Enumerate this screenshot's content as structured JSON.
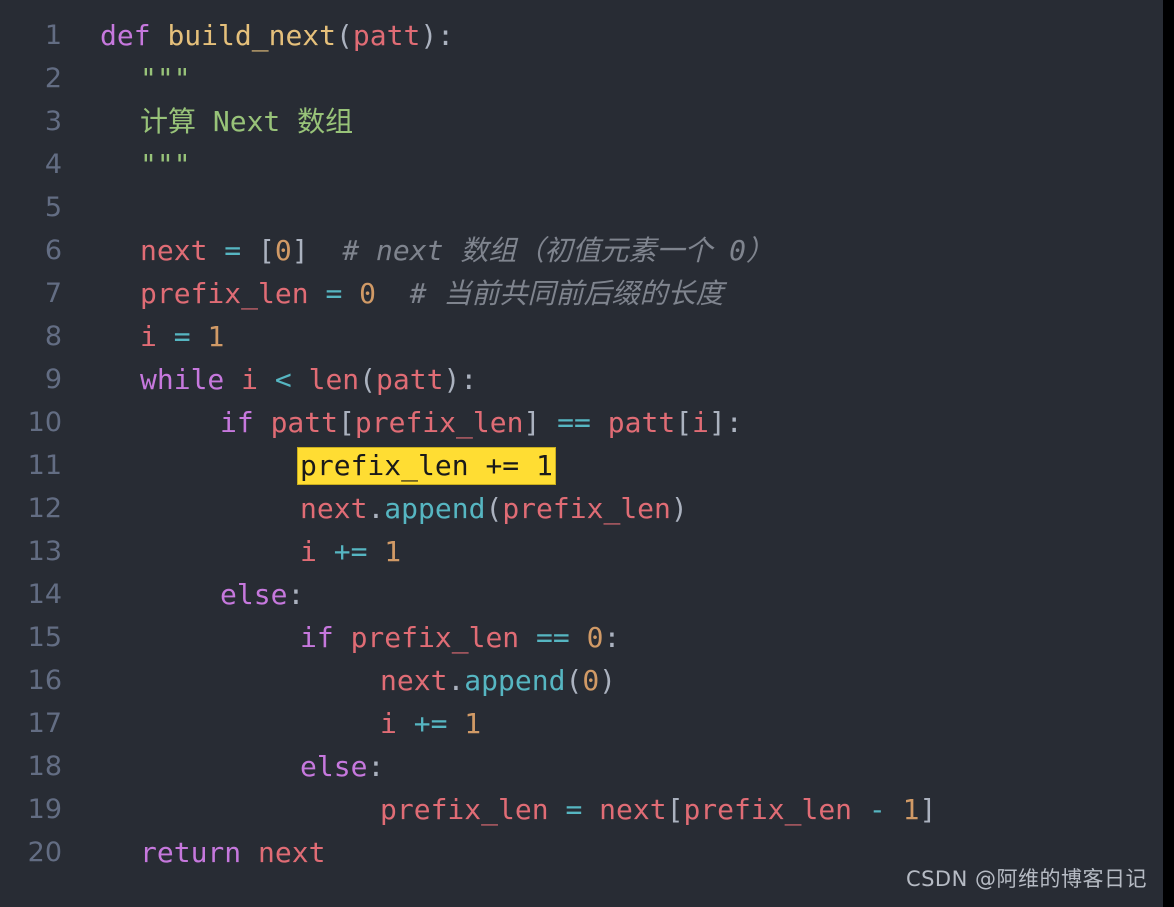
{
  "editor": {
    "language": "python",
    "theme": "One Dark",
    "background_color": "#282c34",
    "gutter_color": "#636d83",
    "highlight_color": "#ffdd33",
    "highlight_text_color": "#1a1a1a",
    "font_size_px": 28,
    "line_height_px": 43,
    "total_lines": 20
  },
  "lines": [
    {
      "number": "1",
      "text": "    def build_next(patt):"
    },
    {
      "number": "2",
      "text": "        \"\"\""
    },
    {
      "number": "3",
      "text": "        计算 Next 数组"
    },
    {
      "number": "4",
      "text": "        \"\"\""
    },
    {
      "number": "5",
      "text": ""
    },
    {
      "number": "6",
      "text": "        next = [0]  # next 数组（初值元素一个 0）"
    },
    {
      "number": "7",
      "text": "        prefix_len = 0  # 当前共同前后缀的长度"
    },
    {
      "number": "8",
      "text": "        i = 1"
    },
    {
      "number": "9",
      "text": "        while i < len(patt):"
    },
    {
      "number": "10",
      "text": "            if patt[prefix_len] == patt[i]:"
    },
    {
      "number": "11",
      "text": "                prefix_len += 1"
    },
    {
      "number": "12",
      "text": "                next.append(prefix_len)"
    },
    {
      "number": "13",
      "text": "                i += 1"
    },
    {
      "number": "14",
      "text": "            else:"
    },
    {
      "number": "15",
      "text": "                if prefix_len == 0:"
    },
    {
      "number": "16",
      "text": "                    next.append(0)"
    },
    {
      "number": "17",
      "text": "                    i += 1"
    },
    {
      "number": "18",
      "text": "                else:"
    },
    {
      "number": "19",
      "text": "                    prefix_len = next[prefix_len - 1]"
    },
    {
      "number": "20",
      "text": "        return next"
    }
  ],
  "tokens": {
    "l1": {
      "kw": "def",
      "fn": "build_next",
      "p1": "(",
      "arg": "patt",
      "p2": "):"
    },
    "l2": {
      "quote": "\"\"\""
    },
    "l3": {
      "text": "计算 Next 数组"
    },
    "l4": {
      "quote": "\"\"\""
    },
    "l6": {
      "var": "next",
      "op": "=",
      "b1": "[",
      "num": "0",
      "b2": "]",
      "comment": "# next 数组（初值元素一个 0）"
    },
    "l7": {
      "var": "prefix_len",
      "op": "=",
      "num": "0",
      "comment": "# 当前共同前后缀的长度"
    },
    "l8": {
      "var": "i",
      "op": "=",
      "num": "1"
    },
    "l9": {
      "kw": "while",
      "var": "i",
      "op": "<",
      "fn": "len",
      "p1": "(",
      "arg": "patt",
      "p2": "):"
    },
    "l10": {
      "kw": "if",
      "v1": "patt",
      "b1": "[",
      "v2": "prefix_len",
      "b2": "]",
      "op": "==",
      "v3": "patt",
      "b3": "[",
      "v4": "i",
      "b4": "]:"
    },
    "l11": {
      "var": "prefix_len",
      "op": "+=",
      "num": "1"
    },
    "l12": {
      "var": "next",
      "dot": ".",
      "meth": "append",
      "p1": "(",
      "arg": "prefix_len",
      "p2": ")"
    },
    "l13": {
      "var": "i",
      "op": "+=",
      "num": "1"
    },
    "l14": {
      "kw": "else",
      "colon": ":"
    },
    "l15": {
      "kw": "if",
      "var": "prefix_len",
      "op": "==",
      "num": "0",
      "colon": ":"
    },
    "l16": {
      "var": "next",
      "dot": ".",
      "meth": "append",
      "p1": "(",
      "num": "0",
      "p2": ")"
    },
    "l17": {
      "var": "i",
      "op": "+=",
      "num": "1"
    },
    "l18": {
      "kw": "else",
      "colon": ":"
    },
    "l19": {
      "v1": "prefix_len",
      "op": "=",
      "v2": "next",
      "b1": "[",
      "v3": "prefix_len",
      "op2": "-",
      "num": "1",
      "b2": "]"
    },
    "l20": {
      "kw": "return",
      "var": "next"
    }
  },
  "highlight": {
    "line_number": "11",
    "text": "prefix_len += 1"
  },
  "watermark": {
    "text": "CSDN @阿维的博客日记"
  }
}
